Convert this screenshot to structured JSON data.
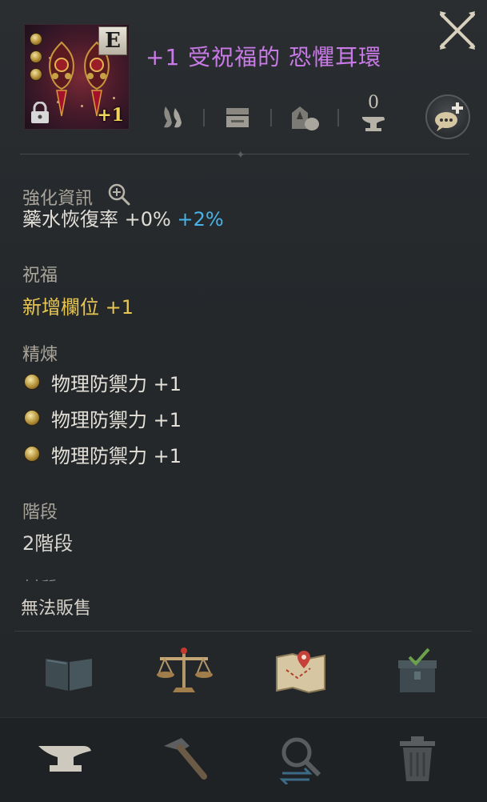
{
  "item": {
    "title": "+1 受祝福的 恐懼耳環",
    "grade": "E",
    "enhancement": "+1"
  },
  "header_icons": {
    "stack_count": "0"
  },
  "sections": {
    "enhance_info_label": "強化資訊",
    "enhance_info_line": "藥水恢復率 +0%",
    "enhance_info_bonus": "+2%",
    "blessing_label": "祝福",
    "blessing_value": "新增欄位 +1",
    "refine_label": "精煉",
    "refine_items": [
      "物理防禦力 +1",
      "物理防禦力 +1",
      "物理防禦力 +1"
    ],
    "tier_label": "階段",
    "tier_value": "2階段",
    "cut_label": "材質",
    "not_sellable": "無法販售"
  },
  "colors": {
    "title": "#c87ae6",
    "gold": "#e8c652",
    "bonus_blue": "#48b3e6"
  }
}
